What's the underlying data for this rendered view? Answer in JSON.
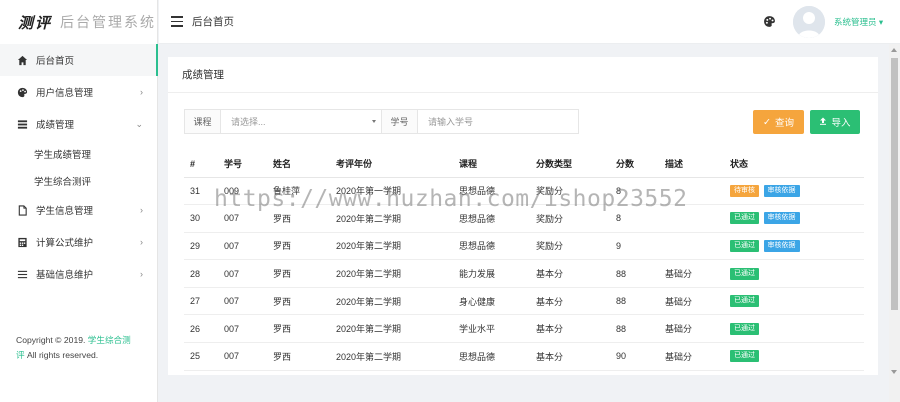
{
  "logo": {
    "bold": "测评",
    "light": "后台管理系统"
  },
  "header": {
    "breadcrumb": "后台首页",
    "user_name": "系统管理员 ▾"
  },
  "sidebar": {
    "items": [
      {
        "label": "后台首页",
        "icon": "home-icon"
      },
      {
        "label": "用户信息管理",
        "icon": "palette-icon",
        "arrow": "›"
      },
      {
        "label": "成绩管理",
        "icon": "list-icon",
        "arrow": "⌄"
      },
      {
        "label": "学生信息管理",
        "icon": "document-icon",
        "arrow": "›"
      },
      {
        "label": "计算公式维护",
        "icon": "calculator-icon",
        "arrow": "›"
      },
      {
        "label": "基础信息维护",
        "icon": "menu-icon",
        "arrow": "›"
      }
    ],
    "subitems": [
      {
        "label": "学生成绩管理"
      },
      {
        "label": "学生综合测评"
      }
    ],
    "copyright": {
      "prefix": "Copyright © 2019.",
      "link1": "学生综合测",
      "link2": "评",
      "suffix": "All rights reserved."
    }
  },
  "card": {
    "title": "成绩管理"
  },
  "search": {
    "course_label": "课程",
    "course_placeholder": "请选择...",
    "id_label": "学号",
    "id_placeholder": "请输入学号",
    "query_label": "查询",
    "import_label": "导入"
  },
  "table": {
    "headers": [
      "#",
      "学号",
      "姓名",
      "考评年份",
      "课程",
      "分数类型",
      "分数",
      "描述",
      "状态"
    ],
    "rows": [
      {
        "no": "31",
        "sid": "009",
        "name": "鲁桂萍",
        "year": "2020年第一学期",
        "course": "思想品德",
        "type": "奖励分",
        "score": "8",
        "desc": "",
        "b1": "待审核",
        "b2": "审核依据"
      },
      {
        "no": "30",
        "sid": "007",
        "name": "罗西",
        "year": "2020年第二学期",
        "course": "思想品德",
        "type": "奖励分",
        "score": "8",
        "desc": "",
        "b1": "已通过",
        "b2": "审核依据"
      },
      {
        "no": "29",
        "sid": "007",
        "name": "罗西",
        "year": "2020年第二学期",
        "course": "思想品德",
        "type": "奖励分",
        "score": "9",
        "desc": "",
        "b1": "已通过",
        "b2": "审核依据"
      },
      {
        "no": "28",
        "sid": "007",
        "name": "罗西",
        "year": "2020年第二学期",
        "course": "能力发展",
        "type": "基本分",
        "score": "88",
        "desc": "基础分",
        "b1": "已通过"
      },
      {
        "no": "27",
        "sid": "007",
        "name": "罗西",
        "year": "2020年第二学期",
        "course": "身心健康",
        "type": "基本分",
        "score": "88",
        "desc": "基础分",
        "b1": "已通过"
      },
      {
        "no": "26",
        "sid": "007",
        "name": "罗西",
        "year": "2020年第二学期",
        "course": "学业水平",
        "type": "基本分",
        "score": "88",
        "desc": "基础分",
        "b1": "已通过"
      },
      {
        "no": "25",
        "sid": "007",
        "name": "罗西",
        "year": "2020年第二学期",
        "course": "思想品德",
        "type": "基本分",
        "score": "90",
        "desc": "基础分",
        "b1": "已通过"
      }
    ]
  },
  "watermark": "https://www.huzhan.com/ishop23552",
  "colors": {
    "accent": "#2bbf8f",
    "success": "#2bbf74",
    "warning": "#f5a53d",
    "info": "#3ba5e6"
  }
}
